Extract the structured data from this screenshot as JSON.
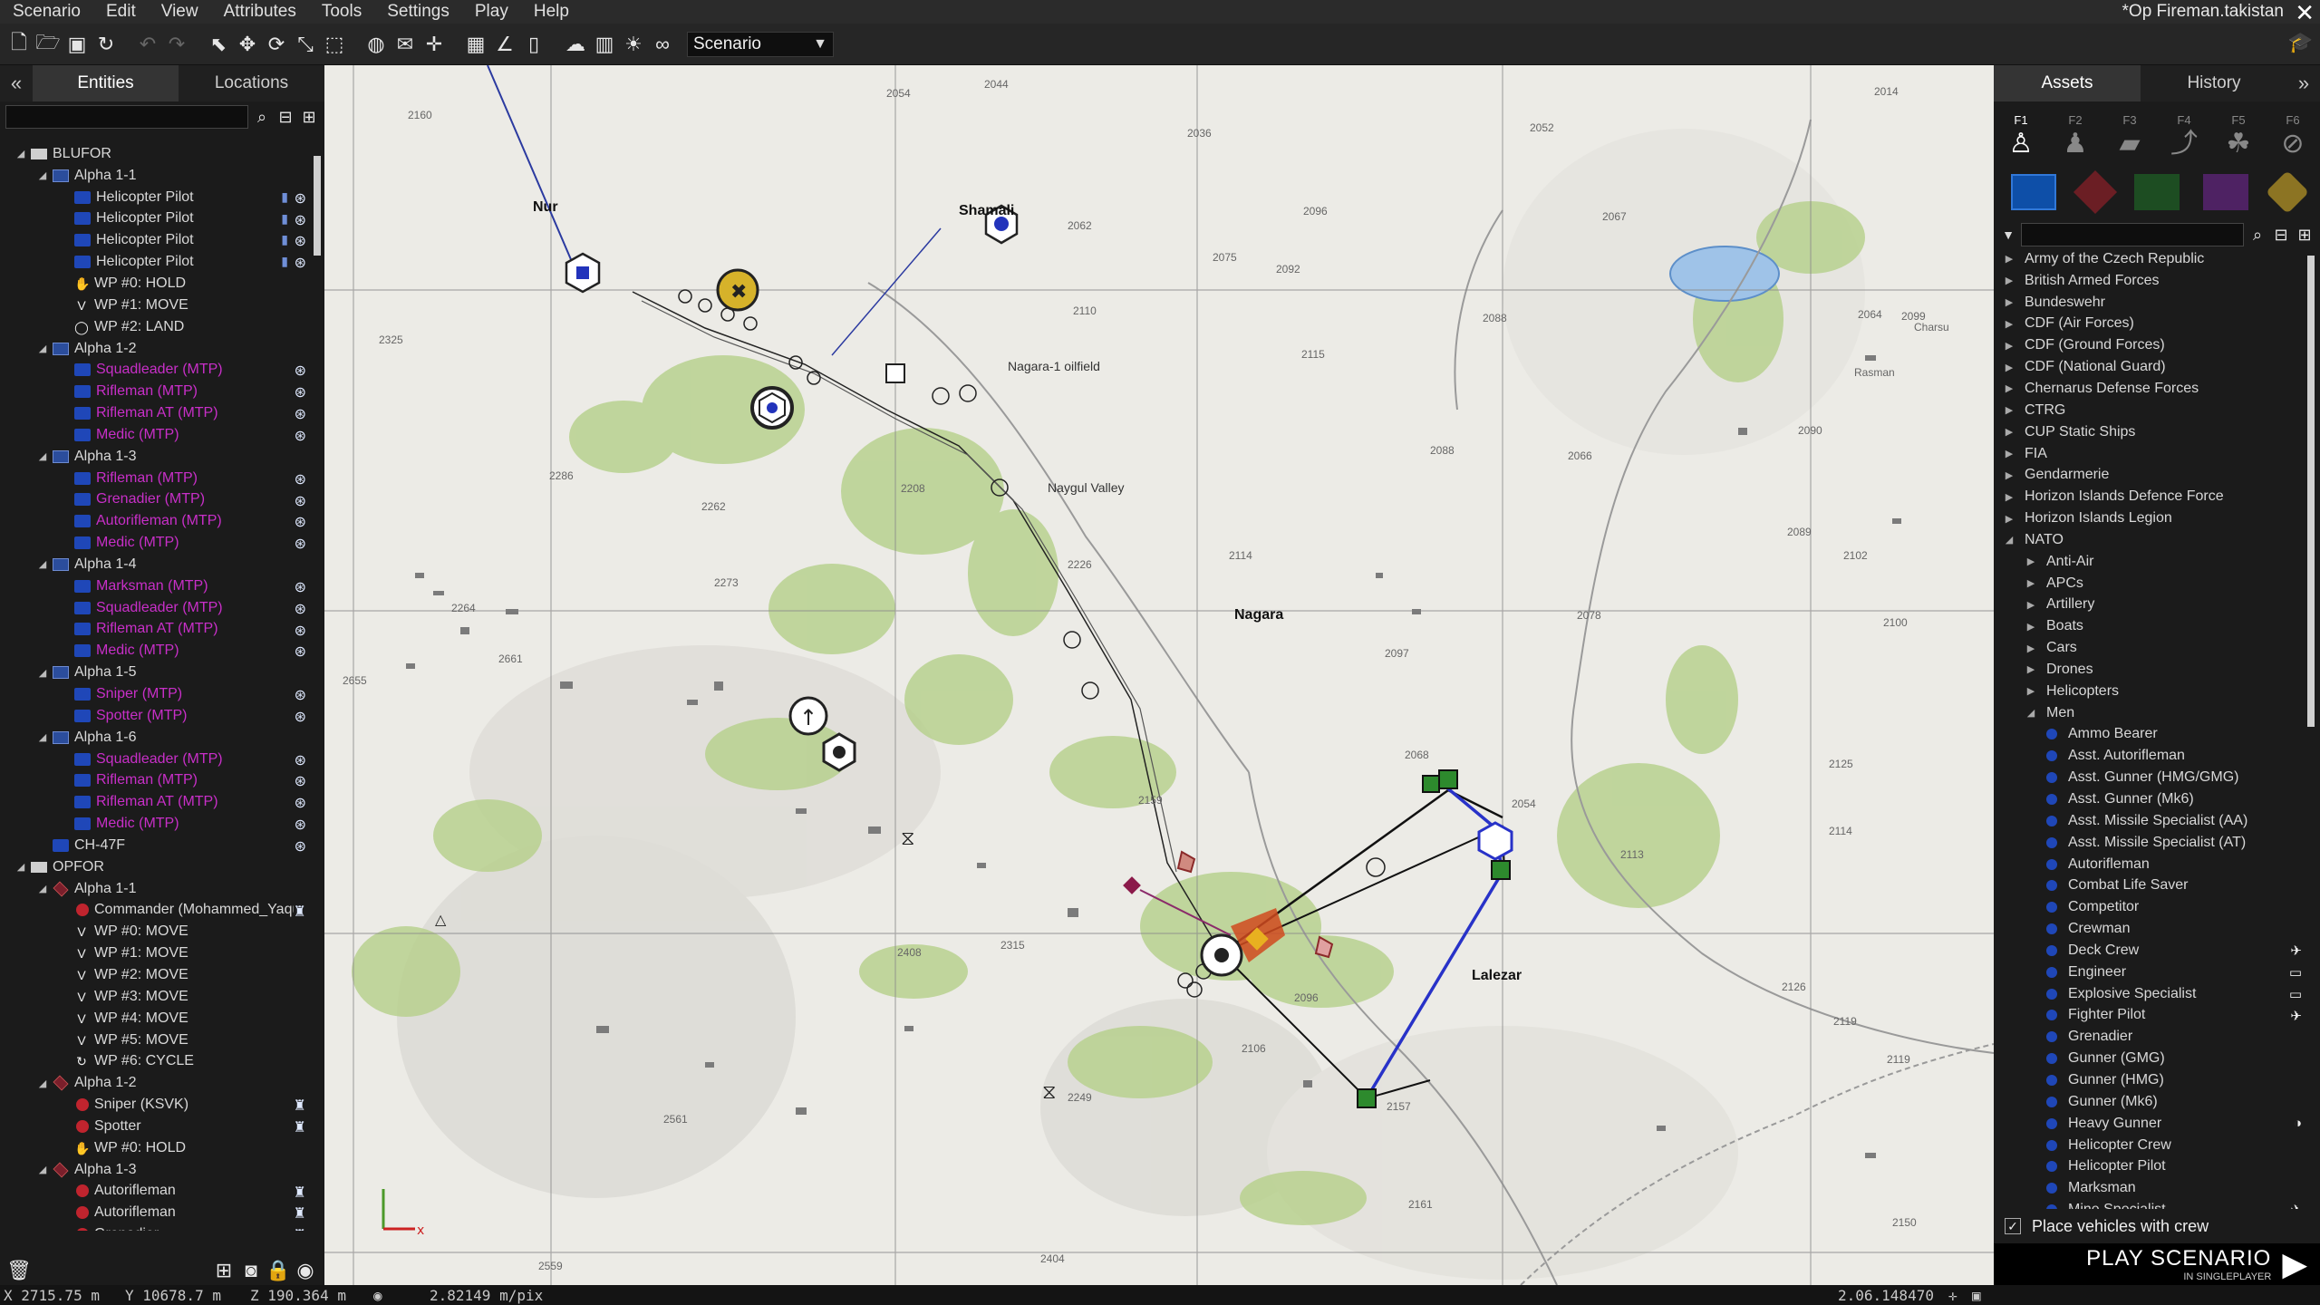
{
  "menubar": {
    "items": [
      "Scenario",
      "Edit",
      "View",
      "Attributes",
      "Tools",
      "Settings",
      "Play",
      "Help"
    ],
    "title": "*Op Fireman.takistan"
  },
  "toolbar": {
    "scenario_select": "Scenario"
  },
  "left_panel": {
    "tabs": [
      "Entities",
      "Locations"
    ],
    "collapse": "«",
    "tree": [
      {
        "depth": 0,
        "arrow": "◢",
        "icon": "folder",
        "label": "BLUFOR",
        "tail": ""
      },
      {
        "depth": 1,
        "arrow": "◢",
        "icon": "flag-blue",
        "label": "Alpha 1-1",
        "tail": ""
      },
      {
        "depth": 2,
        "arrow": "",
        "icon": "unit-blue",
        "label": "Helicopter Pilot",
        "tail": "⊛",
        "tail2": "▮"
      },
      {
        "depth": 2,
        "arrow": "",
        "icon": "unit-blue",
        "label": "Helicopter Pilot",
        "tail": "⊛",
        "tail2": "▮"
      },
      {
        "depth": 2,
        "arrow": "",
        "icon": "unit-blue",
        "label": "Helicopter Pilot",
        "tail": "⊛",
        "tail2": "▮"
      },
      {
        "depth": 2,
        "arrow": "",
        "icon": "unit-blue",
        "label": "Helicopter Pilot",
        "tail": "⊛",
        "tail2": "▮"
      },
      {
        "depth": 2,
        "arrow": "",
        "icon": "wp",
        "glyph": "✋",
        "label": "WP #0: HOLD",
        "tail": ""
      },
      {
        "depth": 2,
        "arrow": "",
        "icon": "wp",
        "glyph": "V",
        "label": "WP #1: MOVE",
        "tail": ""
      },
      {
        "depth": 2,
        "arrow": "",
        "icon": "wp",
        "glyph": "◯",
        "label": "WP #2: LAND",
        "tail": ""
      },
      {
        "depth": 1,
        "arrow": "◢",
        "icon": "flag-blue",
        "label": "Alpha 1-2",
        "tail": ""
      },
      {
        "depth": 2,
        "arrow": "",
        "icon": "unit-blue",
        "label": "Squadleader (MTP)",
        "magenta": true,
        "tail": "⊛"
      },
      {
        "depth": 2,
        "arrow": "",
        "icon": "unit-blue",
        "label": "Rifleman (MTP)",
        "magenta": true,
        "tail": "⊛"
      },
      {
        "depth": 2,
        "arrow": "",
        "icon": "unit-blue",
        "label": "Rifleman AT (MTP)",
        "magenta": true,
        "tail": "⊛"
      },
      {
        "depth": 2,
        "arrow": "",
        "icon": "unit-blue",
        "label": "Medic (MTP)",
        "magenta": true,
        "tail": "⊛"
      },
      {
        "depth": 1,
        "arrow": "◢",
        "icon": "flag-blue",
        "label": "Alpha 1-3",
        "tail": ""
      },
      {
        "depth": 2,
        "arrow": "",
        "icon": "unit-blue",
        "label": "Rifleman (MTP)",
        "magenta": true,
        "tail": "⊛"
      },
      {
        "depth": 2,
        "arrow": "",
        "icon": "unit-blue",
        "label": "Grenadier (MTP)",
        "magenta": true,
        "tail": "⊛"
      },
      {
        "depth": 2,
        "arrow": "",
        "icon": "unit-blue",
        "label": "Autorifleman (MTP)",
        "magenta": true,
        "tail": "⊛"
      },
      {
        "depth": 2,
        "arrow": "",
        "icon": "unit-blue",
        "label": "Medic (MTP)",
        "magenta": true,
        "tail": "⊛"
      },
      {
        "depth": 1,
        "arrow": "◢",
        "icon": "flag-blue",
        "label": "Alpha 1-4",
        "tail": ""
      },
      {
        "depth": 2,
        "arrow": "",
        "icon": "unit-blue",
        "label": "Marksman (MTP)",
        "magenta": true,
        "tail": "⊛"
      },
      {
        "depth": 2,
        "arrow": "",
        "icon": "unit-blue",
        "label": "Squadleader (MTP)",
        "magenta": true,
        "tail": "⊛"
      },
      {
        "depth": 2,
        "arrow": "",
        "icon": "unit-blue",
        "label": "Rifleman AT (MTP)",
        "magenta": true,
        "tail": "⊛"
      },
      {
        "depth": 2,
        "arrow": "",
        "icon": "unit-blue",
        "label": "Medic (MTP)",
        "magenta": true,
        "tail": "⊛"
      },
      {
        "depth": 1,
        "arrow": "◢",
        "icon": "flag-blue",
        "label": "Alpha 1-5",
        "tail": ""
      },
      {
        "depth": 2,
        "arrow": "",
        "icon": "unit-blue",
        "label": "Sniper (MTP)",
        "magenta": true,
        "tail": "⊛"
      },
      {
        "depth": 2,
        "arrow": "",
        "icon": "unit-blue",
        "label": "Spotter (MTP)",
        "magenta": true,
        "tail": "⊛"
      },
      {
        "depth": 1,
        "arrow": "◢",
        "icon": "flag-blue",
        "label": "Alpha 1-6",
        "tail": ""
      },
      {
        "depth": 2,
        "arrow": "",
        "icon": "unit-blue",
        "label": "Squadleader (MTP)",
        "magenta": true,
        "tail": "⊛"
      },
      {
        "depth": 2,
        "arrow": "",
        "icon": "unit-blue",
        "label": "Rifleman (MTP)",
        "magenta": true,
        "tail": "⊛"
      },
      {
        "depth": 2,
        "arrow": "",
        "icon": "unit-blue",
        "label": "Rifleman AT (MTP)",
        "magenta": true,
        "tail": "⊛"
      },
      {
        "depth": 2,
        "arrow": "",
        "icon": "unit-blue",
        "label": "Medic (MTP)",
        "magenta": true,
        "tail": "⊛"
      },
      {
        "depth": 1,
        "arrow": "",
        "icon": "unit-blue",
        "label": "CH-47F",
        "tail": "⊛"
      },
      {
        "depth": 0,
        "arrow": "◢",
        "icon": "folder",
        "label": "OPFOR",
        "tail": ""
      },
      {
        "depth": 1,
        "arrow": "◢",
        "icon": "flag-red",
        "label": "Alpha 1-1",
        "tail": ""
      },
      {
        "depth": 2,
        "arrow": "",
        "icon": "unit-red",
        "label": "Commander (Mohammed_Yaqub)",
        "tail": "♜"
      },
      {
        "depth": 2,
        "arrow": "",
        "icon": "wp",
        "glyph": "V",
        "label": "WP #0: MOVE",
        "tail": ""
      },
      {
        "depth": 2,
        "arrow": "",
        "icon": "wp",
        "glyph": "V",
        "label": "WP #1: MOVE",
        "tail": ""
      },
      {
        "depth": 2,
        "arrow": "",
        "icon": "wp",
        "glyph": "V",
        "label": "WP #2: MOVE",
        "tail": ""
      },
      {
        "depth": 2,
        "arrow": "",
        "icon": "wp",
        "glyph": "V",
        "label": "WP #3: MOVE",
        "tail": ""
      },
      {
        "depth": 2,
        "arrow": "",
        "icon": "wp",
        "glyph": "V",
        "label": "WP #4: MOVE",
        "tail": ""
      },
      {
        "depth": 2,
        "arrow": "",
        "icon": "wp",
        "glyph": "V",
        "label": "WP #5: MOVE",
        "tail": ""
      },
      {
        "depth": 2,
        "arrow": "",
        "icon": "wp",
        "glyph": "↻",
        "label": "WP #6: CYCLE",
        "tail": ""
      },
      {
        "depth": 1,
        "arrow": "◢",
        "icon": "flag-red",
        "label": "Alpha 1-2",
        "tail": ""
      },
      {
        "depth": 2,
        "arrow": "",
        "icon": "unit-red",
        "label": "Sniper (KSVK)",
        "tail": "♜"
      },
      {
        "depth": 2,
        "arrow": "",
        "icon": "unit-red",
        "label": "Spotter",
        "tail": "♜"
      },
      {
        "depth": 2,
        "arrow": "",
        "icon": "wp",
        "glyph": "✋",
        "label": "WP #0: HOLD",
        "tail": ""
      },
      {
        "depth": 1,
        "arrow": "◢",
        "icon": "flag-red",
        "label": "Alpha 1-3",
        "tail": ""
      },
      {
        "depth": 2,
        "arrow": "",
        "icon": "unit-red",
        "label": "Autorifleman",
        "tail": "♜"
      },
      {
        "depth": 2,
        "arrow": "",
        "icon": "unit-red",
        "label": "Autorifleman",
        "tail": "♜"
      },
      {
        "depth": 2,
        "arrow": "",
        "icon": "unit-red",
        "label": "Grenadier",
        "tail": "♜"
      }
    ]
  },
  "right_panel": {
    "tabs": [
      "Assets",
      "History"
    ],
    "expand": "»",
    "fkeys": [
      "F1",
      "F2",
      "F3",
      "F4",
      "F5",
      "F6"
    ],
    "assets": [
      {
        "depth": 0,
        "arrow": "▶",
        "label": "Army of the Czech Republic"
      },
      {
        "depth": 0,
        "arrow": "▶",
        "label": "British Armed Forces"
      },
      {
        "depth": 0,
        "arrow": "▶",
        "label": "Bundeswehr"
      },
      {
        "depth": 0,
        "arrow": "▶",
        "label": "CDF (Air Forces)"
      },
      {
        "depth": 0,
        "arrow": "▶",
        "label": "CDF (Ground Forces)"
      },
      {
        "depth": 0,
        "arrow": "▶",
        "label": "CDF (National Guard)"
      },
      {
        "depth": 0,
        "arrow": "▶",
        "label": "Chernarus Defense Forces"
      },
      {
        "depth": 0,
        "arrow": "▶",
        "label": "CTRG"
      },
      {
        "depth": 0,
        "arrow": "▶",
        "label": "CUP Static Ships"
      },
      {
        "depth": 0,
        "arrow": "▶",
        "label": "FIA"
      },
      {
        "depth": 0,
        "arrow": "▶",
        "label": "Gendarmerie"
      },
      {
        "depth": 0,
        "arrow": "▶",
        "label": "Horizon Islands Defence Force"
      },
      {
        "depth": 0,
        "arrow": "▶",
        "label": "Horizon Islands Legion"
      },
      {
        "depth": 0,
        "arrow": "◢",
        "label": "NATO"
      },
      {
        "depth": 1,
        "arrow": "▶",
        "label": "Anti-Air"
      },
      {
        "depth": 1,
        "arrow": "▶",
        "label": "APCs"
      },
      {
        "depth": 1,
        "arrow": "▶",
        "label": "Artillery"
      },
      {
        "depth": 1,
        "arrow": "▶",
        "label": "Boats"
      },
      {
        "depth": 1,
        "arrow": "▶",
        "label": "Cars"
      },
      {
        "depth": 1,
        "arrow": "▶",
        "label": "Drones"
      },
      {
        "depth": 1,
        "arrow": "▶",
        "label": "Helicopters"
      },
      {
        "depth": 1,
        "arrow": "◢",
        "label": "Men"
      },
      {
        "depth": 2,
        "label": "Ammo Bearer"
      },
      {
        "depth": 2,
        "label": "Asst. Autorifleman"
      },
      {
        "depth": 2,
        "label": "Asst. Gunner (HMG/GMG)"
      },
      {
        "depth": 2,
        "label": "Asst. Gunner (Mk6)"
      },
      {
        "depth": 2,
        "label": "Asst. Missile Specialist (AA)"
      },
      {
        "depth": 2,
        "label": "Asst. Missile Specialist (AT)"
      },
      {
        "depth": 2,
        "label": "Autorifleman"
      },
      {
        "depth": 2,
        "label": "Combat Life Saver"
      },
      {
        "depth": 2,
        "label": "Competitor"
      },
      {
        "depth": 2,
        "label": "Crewman"
      },
      {
        "depth": 2,
        "label": "Deck Crew",
        "tail": "✈"
      },
      {
        "depth": 2,
        "label": "Engineer",
        "tail": "▭"
      },
      {
        "depth": 2,
        "label": "Explosive Specialist",
        "tail": "▭"
      },
      {
        "depth": 2,
        "label": "Fighter Pilot",
        "tail": "✈"
      },
      {
        "depth": 2,
        "label": "Grenadier"
      },
      {
        "depth": 2,
        "label": "Gunner (GMG)"
      },
      {
        "depth": 2,
        "label": "Gunner (HMG)"
      },
      {
        "depth": 2,
        "label": "Gunner (Mk6)"
      },
      {
        "depth": 2,
        "label": "Heavy Gunner",
        "tail": "◑"
      },
      {
        "depth": 2,
        "label": "Helicopter Crew"
      },
      {
        "depth": 2,
        "label": "Helicopter Pilot"
      },
      {
        "depth": 2,
        "label": "Marksman"
      },
      {
        "depth": 2,
        "label": "Mine Specialist",
        "tail": "✈"
      }
    ],
    "place_crew_label": "Place vehicles with crew",
    "play_main": "PLAY SCENARIO",
    "play_sub": "IN SINGLEPLAYER"
  },
  "map": {
    "labels": [
      {
        "text": "Nur",
        "cls": "town"
      },
      {
        "text": "Nagara",
        "cls": "town"
      },
      {
        "text": "Shamali",
        "cls": "town"
      },
      {
        "text": "Lalezar",
        "cls": "town"
      },
      {
        "text": "Nagara-1 oilfield",
        "cls": ""
      },
      {
        "text": "Naygul Valley",
        "cls": ""
      },
      {
        "text": "Charsu",
        "cls": "small"
      },
      {
        "text": "Rasman",
        "cls": "small"
      }
    ],
    "elevations": [
      "2160",
      "2054",
      "2044",
      "2036",
      "2052",
      "2014",
      "2062",
      "2096",
      "2075",
      "2067",
      "2325",
      "2110",
      "2092",
      "2088",
      "2064",
      "2099",
      "2115",
      "2286",
      "2262",
      "2208",
      "2088",
      "2090",
      "2066",
      "2102",
      "2089",
      "2114",
      "2226",
      "2273",
      "2264",
      "2078",
      "2097",
      "2100",
      "2661",
      "2655",
      "2068",
      "2125",
      "2159",
      "2054",
      "2113",
      "2114",
      "2408",
      "2315",
      "2096",
      "2119",
      "2126",
      "2106",
      "2157",
      "2249",
      "2561",
      "2161",
      "2559",
      "2404",
      "2119",
      "2150"
    ]
  },
  "status": {
    "x": "X 2715.75 m",
    "y": "Y 10678.7 m",
    "z": "Z 190.364 m",
    "scale": "2.82149 m/pix",
    "version": "2.06.148470"
  }
}
